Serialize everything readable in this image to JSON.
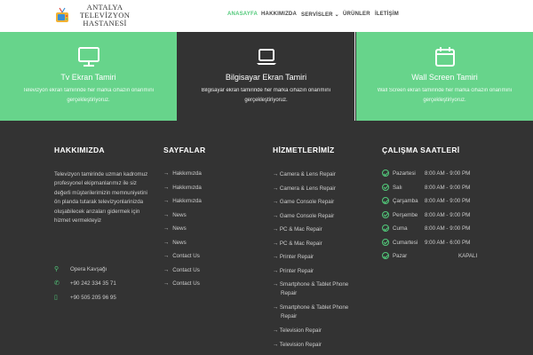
{
  "header": {
    "logo_lines": [
      "ANTALYA",
      "TELEVİZYON",
      "HASTANESİ"
    ],
    "nav": [
      {
        "label": "ANASAYFA",
        "active": true
      },
      {
        "label": "HAKKIMIZDA",
        "active": false
      },
      {
        "label": "SERVİSLER",
        "active": false,
        "dropdown": true
      },
      {
        "label": "ÜRÜNLER",
        "active": false
      },
      {
        "label": "İLETİŞİM",
        "active": false
      }
    ]
  },
  "features": [
    {
      "icon": "monitor-icon",
      "title": "Tv Ekran Tamiri",
      "text": "Televizyon ekran tamirinde her marka cihazın onarımını gerçekleştiriyoruz."
    },
    {
      "icon": "laptop-icon",
      "title": "Bilgisayar Ekran Tamiri",
      "text": "Bilgisayar ekran tamirinde her marka cihazın onarımını gerçekleştiriyoruz."
    },
    {
      "icon": "calendar-icon",
      "title": "Wall Screen Tamiri",
      "text": "Wall Screen ekran tamirinde her marka cihazın onarımını gerçekleştiriyoruz."
    }
  ],
  "footer": {
    "about": {
      "heading": "HAKKIMIZDA",
      "text": "Televizyon tamirinde uzman kadromuz profesyonel ekipmanlarımız ile siz değerli müşterilerimizin memnuniyetini ön planda tutarak televizyonlarinizda oluşabilecek arızaları gidermek için hizmet vermekteyiz",
      "address": "Opera Kavşağı",
      "phone": "+90 242 334 35 71",
      "mobile": "+90 505 205 96 95"
    },
    "pages": {
      "heading": "SAYFALAR",
      "items": [
        "Hakkımızda",
        "Hakkımızda",
        "Hakkımızda",
        "News",
        "News",
        "News",
        "Contact Us",
        "Contact Us",
        "Contact Us"
      ]
    },
    "services": {
      "heading": "HİZMETLERİMİZ",
      "items": [
        "Camera & Lens Repair",
        "Camera & Lens Repair",
        "Game Console Repair",
        "Game Console Repair",
        "PC & Mac Repair",
        "PC & Mac Repair",
        "Printer Repair",
        "Printer Repair",
        "Smartphone & Tablet Phone Repair",
        "Smartphone & Tablet Phone Repair",
        "Television Repair",
        "Television Repair"
      ]
    },
    "hours": {
      "heading": "ÇALIŞMA SAATLERİ",
      "items": [
        {
          "day": "Pazartesi",
          "time": "8:00 AM - 9:00 PM"
        },
        {
          "day": "Salı",
          "time": "8:00 AM - 9:00 PM"
        },
        {
          "day": "Çarşamba",
          "time": "8:00 AM - 9:00 PM"
        },
        {
          "day": "Perşembe",
          "time": "8:00 AM - 9:00 PM"
        },
        {
          "day": "Cuma",
          "time": "8:00 AM - 9:00 PM"
        },
        {
          "day": "Cumartesi",
          "time": "9:00 AM - 6:00 PM"
        },
        {
          "day": "Pazar",
          "time": "KAPALI"
        }
      ]
    }
  },
  "colors": {
    "accent": "#52c97a",
    "feature_green": "#67d48b",
    "dark": "#333333"
  }
}
